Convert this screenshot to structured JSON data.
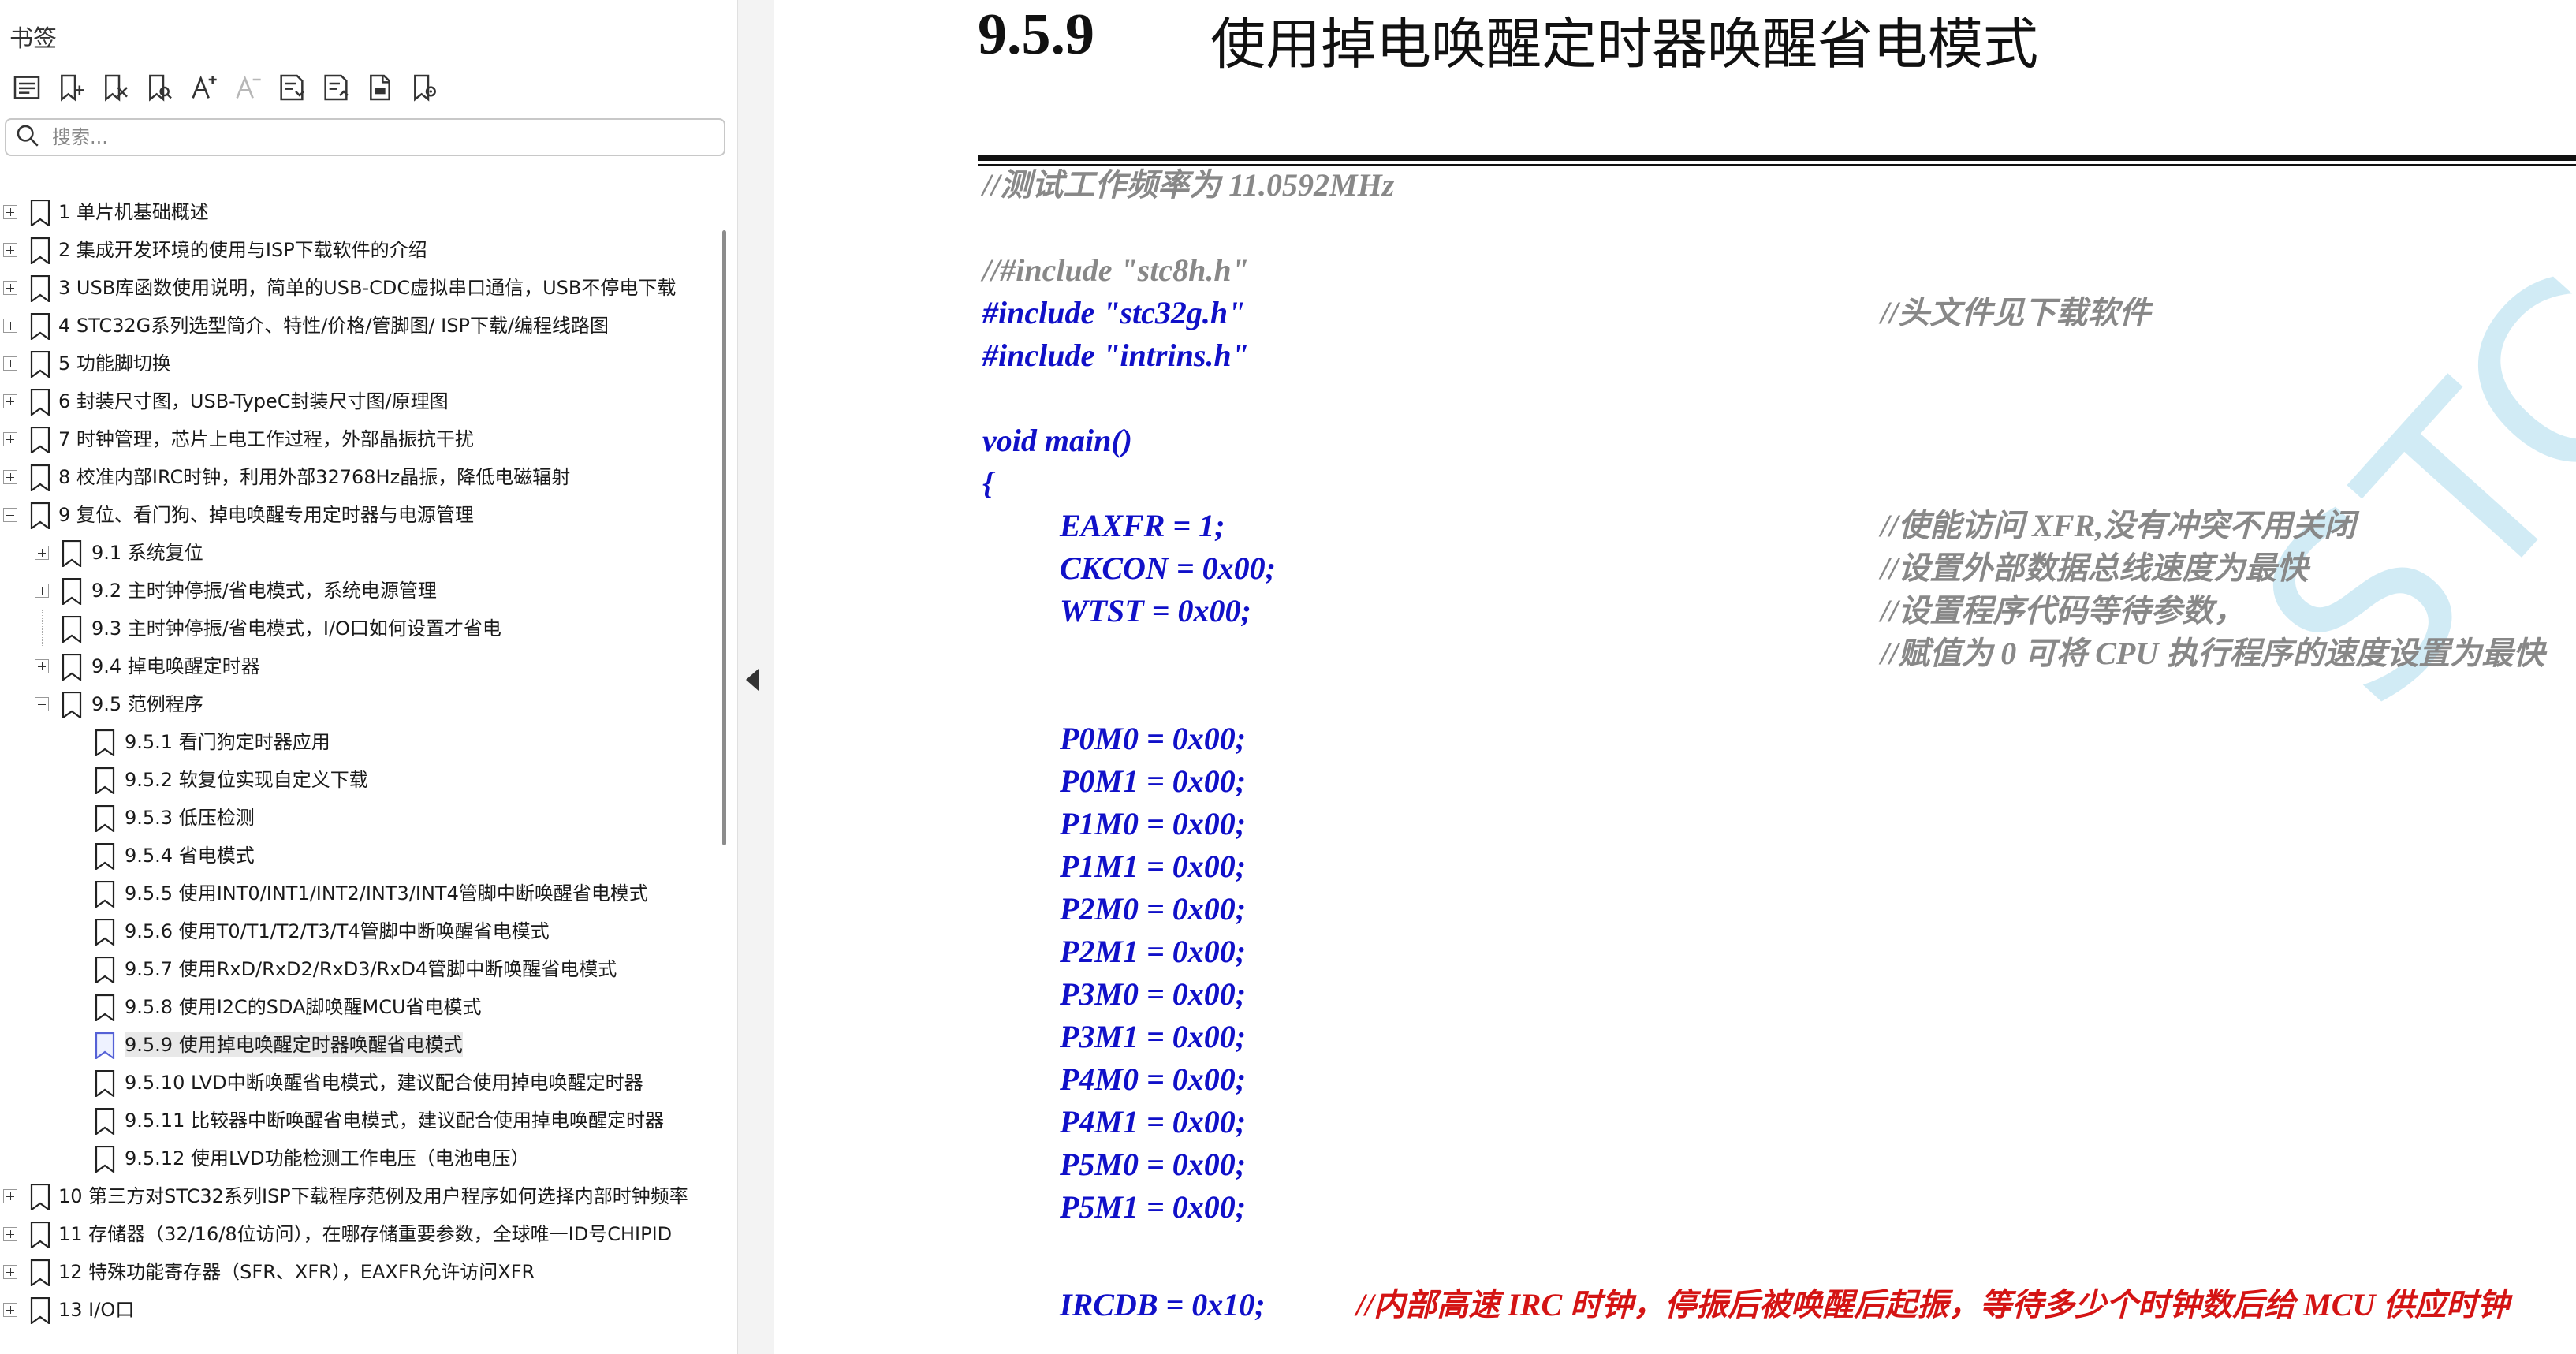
{
  "sidebar": {
    "title": "书签",
    "toolbar": [
      {
        "icon": "outline-view-icon",
        "enabled": true
      },
      {
        "icon": "add-bookmark-icon",
        "enabled": true
      },
      {
        "icon": "delete-bookmark-icon",
        "enabled": true
      },
      {
        "icon": "find-bookmark-icon",
        "enabled": true
      },
      {
        "icon": "text-larger-icon",
        "enabled": true
      },
      {
        "icon": "text-smaller-icon",
        "enabled": false
      },
      {
        "icon": "expand-all-icon",
        "enabled": true
      },
      {
        "icon": "collapse-all-icon",
        "enabled": true
      },
      {
        "icon": "bookmark-properties-icon",
        "enabled": true
      },
      {
        "icon": "bookmark-settings-icon",
        "enabled": true
      }
    ],
    "search_placeholder": "搜索...",
    "tree": [
      {
        "label": "1  单片机基础概述",
        "level": 0,
        "expander": "plus"
      },
      {
        "label": "2  集成开发环境的使用与ISP下载软件的介绍",
        "level": 0,
        "expander": "plus"
      },
      {
        "label": "3 USB库函数使用说明，简单的USB-CDC虚拟串口通信，USB不停电下载",
        "level": 0,
        "expander": "plus"
      },
      {
        "label": "4  STC32G系列选型简介、特性/价格/管脚图/ ISP下载/编程线路图",
        "level": 0,
        "expander": "plus"
      },
      {
        "label": "5  功能脚切换",
        "level": 0,
        "expander": "plus"
      },
      {
        "label": "6  封装尺寸图，USB-TypeC封装尺寸图/原理图",
        "level": 0,
        "expander": "plus"
      },
      {
        "label": "7  时钟管理，芯片上电工作过程，外部晶振抗干扰",
        "level": 0,
        "expander": "plus"
      },
      {
        "label": "8  校准内部IRC时钟，利用外部32768Hz晶振，降低电磁辐射",
        "level": 0,
        "expander": "plus"
      },
      {
        "label": "9  复位、看门狗、掉电唤醒专用定时器与电源管理",
        "level": 0,
        "expander": "minus"
      },
      {
        "label": "9.1  系统复位",
        "level": 1,
        "expander": "plus"
      },
      {
        "label": "9.2  主时钟停振/省电模式，系统电源管理",
        "level": 1,
        "expander": "plus"
      },
      {
        "label": "9.3  主时钟停振/省电模式，I/O口如何设置才省电",
        "level": 1,
        "expander": "none"
      },
      {
        "label": "9.4  掉电唤醒定时器",
        "level": 1,
        "expander": "plus"
      },
      {
        "label": "9.5  范例程序",
        "level": 1,
        "expander": "minus"
      },
      {
        "label": "9.5.1  看门狗定时器应用",
        "level": 2,
        "expander": "none"
      },
      {
        "label": "9.5.2  软复位实现自定义下载",
        "level": 2,
        "expander": "none"
      },
      {
        "label": "9.5.3  低压检测",
        "level": 2,
        "expander": "none"
      },
      {
        "label": "9.5.4  省电模式",
        "level": 2,
        "expander": "none"
      },
      {
        "label": "9.5.5  使用INT0/INT1/INT2/INT3/INT4管脚中断唤醒省电模式",
        "level": 2,
        "expander": "none"
      },
      {
        "label": "9.5.6  使用T0/T1/T2/T3/T4管脚中断唤醒省电模式",
        "level": 2,
        "expander": "none"
      },
      {
        "label": "9.5.7  使用RxD/RxD2/RxD3/RxD4管脚中断唤醒省电模式",
        "level": 2,
        "expander": "none"
      },
      {
        "label": "9.5.8  使用I2C的SDA脚唤醒MCU省电模式",
        "level": 2,
        "expander": "none"
      },
      {
        "label": "9.5.9  使用掉电唤醒定时器唤醒省电模式",
        "level": 2,
        "expander": "none",
        "selected": true
      },
      {
        "label": "9.5.10  LVD中断唤醒省电模式，建议配合使用掉电唤醒定时器",
        "level": 2,
        "expander": "none"
      },
      {
        "label": "9.5.11  比较器中断唤醒省电模式，建议配合使用掉电唤醒定时器",
        "level": 2,
        "expander": "none"
      },
      {
        "label": "9.5.12  使用LVD功能检测工作电压（电池电压）",
        "level": 2,
        "expander": "none"
      },
      {
        "label": "10  第三方对STC32系列ISP下载程序范例及用户程序如何选择内部时钟频率",
        "level": 0,
        "expander": "plus"
      },
      {
        "label": "11  存储器（32/16/8位访问），在哪存储重要参数，全球唯一ID号CHIPID",
        "level": 0,
        "expander": "plus"
      },
      {
        "label": "12  特殊功能寄存器（SFR、XFR），EAXFR允许访问XFR",
        "level": 0,
        "expander": "plus"
      },
      {
        "label": "13  I/O口",
        "level": 0,
        "expander": "plus"
      }
    ]
  },
  "document": {
    "section_number": "9.5.9",
    "section_title": "使用掉电唤醒定时器唤醒省电模式",
    "watermark": "STC MCU",
    "code_lines": [
      {
        "text": "//测试工作频率为 11.0592MHz",
        "style": "comment",
        "indent": 0,
        "row": 0
      },
      {
        "text": "//#include \"stc8h.h\"",
        "style": "comment",
        "indent": 0,
        "row": 2
      },
      {
        "text": "#include \"stc32g.h\"",
        "style": "code",
        "indent": 0,
        "row": 3,
        "comment": "//头文件见下载软件"
      },
      {
        "text": "#include \"intrins.h\"",
        "style": "code",
        "indent": 0,
        "row": 4
      },
      {
        "text": "void main()",
        "style": "code",
        "indent": 0,
        "row": 6
      },
      {
        "text": "{",
        "style": "code",
        "indent": 0,
        "row": 7
      },
      {
        "text": "EAXFR = 1;",
        "style": "code",
        "indent": 1,
        "row": 8,
        "comment": "//使能访问 XFR,没有冲突不用关闭"
      },
      {
        "text": "CKCON = 0x00;",
        "style": "code",
        "indent": 1,
        "row": 9,
        "comment": "//设置外部数据总线速度为最快"
      },
      {
        "text": "WTST = 0x00;",
        "style": "code",
        "indent": 1,
        "row": 10,
        "comment": "//设置程序代码等待参数，"
      },
      {
        "text": "",
        "style": "code",
        "indent": 1,
        "row": 11,
        "comment": "//赋值为 0 可将 CPU 执行程序的速度设置为最快"
      },
      {
        "text": "P0M0 = 0x00;",
        "style": "code",
        "indent": 1,
        "row": 13
      },
      {
        "text": "P0M1 = 0x00;",
        "style": "code",
        "indent": 1,
        "row": 14
      },
      {
        "text": "P1M0 = 0x00;",
        "style": "code",
        "indent": 1,
        "row": 15
      },
      {
        "text": "P1M1 = 0x00;",
        "style": "code",
        "indent": 1,
        "row": 16
      },
      {
        "text": "P2M0 = 0x00;",
        "style": "code",
        "indent": 1,
        "row": 17
      },
      {
        "text": "P2M1 = 0x00;",
        "style": "code",
        "indent": 1,
        "row": 18
      },
      {
        "text": "P3M0 = 0x00;",
        "style": "code",
        "indent": 1,
        "row": 19
      },
      {
        "text": "P3M1 = 0x00;",
        "style": "code",
        "indent": 1,
        "row": 20
      },
      {
        "text": "P4M0 = 0x00;",
        "style": "code",
        "indent": 1,
        "row": 21
      },
      {
        "text": "P4M1 = 0x00;",
        "style": "code",
        "indent": 1,
        "row": 22
      },
      {
        "text": "P5M0 = 0x00;",
        "style": "code",
        "indent": 1,
        "row": 23
      },
      {
        "text": "P5M1 = 0x00;",
        "style": "code",
        "indent": 1,
        "row": 24
      },
      {
        "text": "IRCDB = 0x10;",
        "style": "code",
        "indent": 1,
        "row": 26.3,
        "red_comment": "//内部高速 IRC 时钟，停振后被唤醒后起振，等待多少个时钟数后给 MCU 供应时钟"
      }
    ]
  },
  "colors": {
    "code": "#1010c8",
    "comment": "#888888",
    "red_comment": "#d41414",
    "watermark": "#87cde6"
  }
}
